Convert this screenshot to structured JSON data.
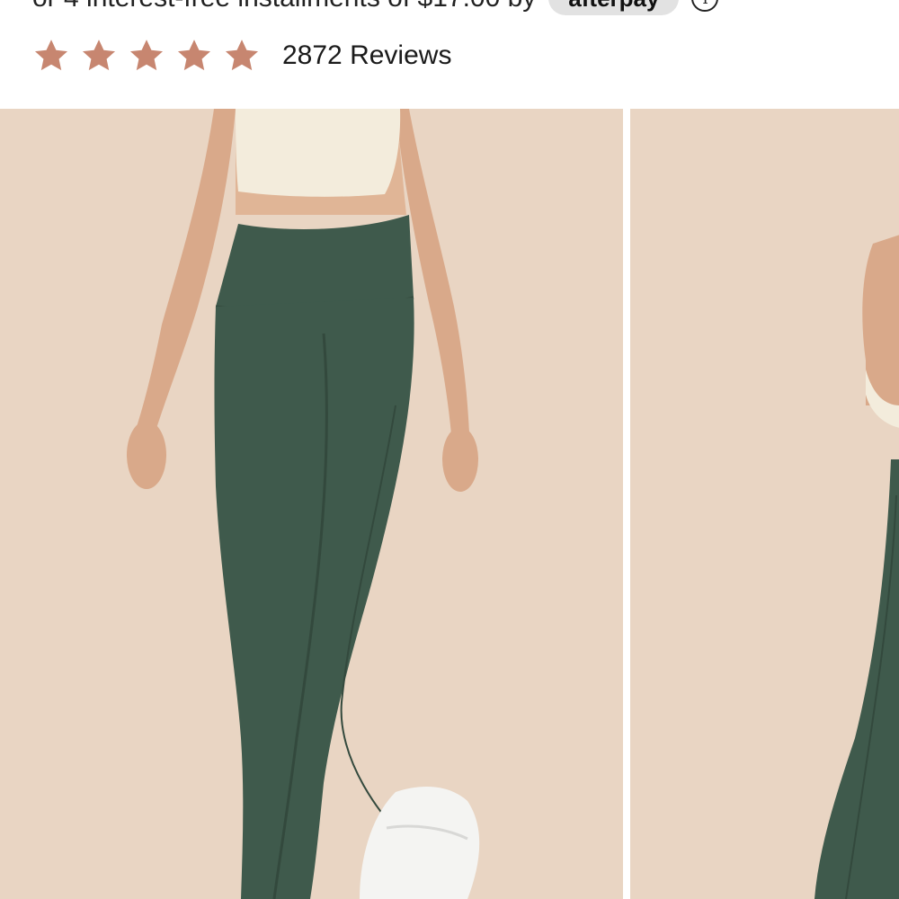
{
  "installments": {
    "text": "or 4 interest-free installments of $17.00 by",
    "provider": "afterpay",
    "provider_mark": "afterpay"
  },
  "rating": {
    "stars": 5,
    "max_stars": 5,
    "star_color": "#c78670",
    "reviews_label": "2872 Reviews"
  },
  "gallery": {
    "background_color": "#e9d5c3",
    "legging_color": "#3f5a4c",
    "slides": [
      {
        "name": "legging-front-view"
      },
      {
        "name": "legging-side-view"
      }
    ]
  }
}
